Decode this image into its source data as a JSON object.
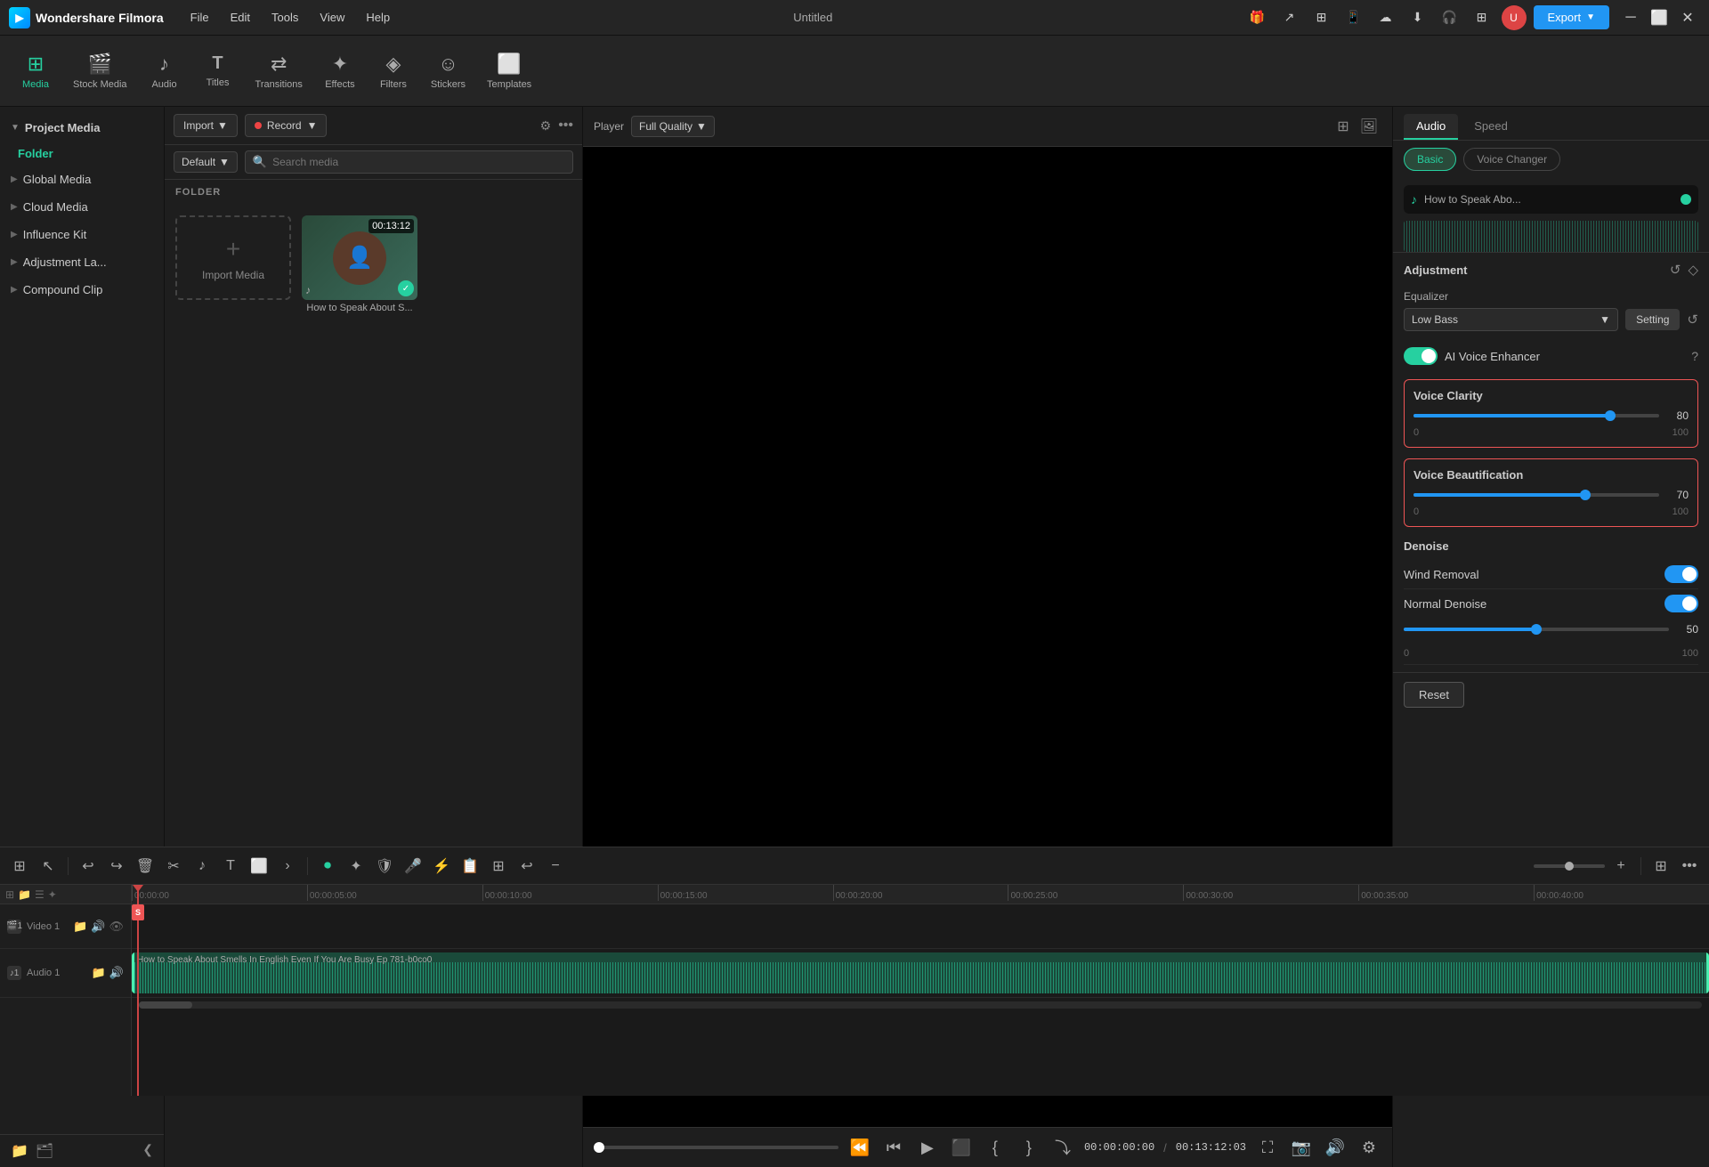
{
  "app": {
    "name": "Wondershare Filmora",
    "title": "Untitled"
  },
  "menu": {
    "items": [
      "File",
      "Edit",
      "Tools",
      "View",
      "Help"
    ]
  },
  "toolbar": {
    "items": [
      {
        "id": "media",
        "label": "Media",
        "icon": "⊞",
        "active": true
      },
      {
        "id": "stock",
        "label": "Stock Media",
        "icon": "🎬"
      },
      {
        "id": "audio",
        "label": "Audio",
        "icon": "♪"
      },
      {
        "id": "titles",
        "label": "Titles",
        "icon": "T"
      },
      {
        "id": "transitions",
        "label": "Transitions",
        "icon": "⇄"
      },
      {
        "id": "effects",
        "label": "Effects",
        "icon": "✦"
      },
      {
        "id": "filters",
        "label": "Filters",
        "icon": "◈"
      },
      {
        "id": "stickers",
        "label": "Stickers",
        "icon": "☺"
      },
      {
        "id": "templates",
        "label": "Templates",
        "icon": "⬜"
      }
    ]
  },
  "sidebar": {
    "items": [
      {
        "label": "Project Media",
        "expanded": true
      },
      {
        "label": "Folder",
        "sub": true
      },
      {
        "label": "Global Media"
      },
      {
        "label": "Cloud Media"
      },
      {
        "label": "Influence Kit"
      },
      {
        "label": "Adjustment La..."
      },
      {
        "label": "Compound Clip"
      }
    ]
  },
  "media_panel": {
    "import_label": "Import",
    "record_label": "Record",
    "sort_label": "Default",
    "search_placeholder": "Search media",
    "folder_label": "FOLDER",
    "import_card_label": "Import Media",
    "media_items": [
      {
        "name": "How to Speak About S...",
        "duration": "00:13:12",
        "has_check": true
      }
    ]
  },
  "preview": {
    "player_label": "Player",
    "quality": "Full Quality",
    "time_current": "00:00:00:00",
    "time_total": "00:13:12:03",
    "time_separator": "/"
  },
  "right_panel": {
    "tabs": [
      "Audio",
      "Speed"
    ],
    "active_tab": "Audio",
    "subtabs": [
      "Basic",
      "Voice Changer"
    ],
    "active_subtab": "Basic",
    "track_name": "How to Speak Abo...",
    "adjustment_label": "Adjustment",
    "equalizer_label": "Equalizer",
    "eq_preset": "Low Bass",
    "eq_setting_btn": "Setting",
    "ai_enhancer_label": "AI Voice Enhancer",
    "voice_clarity": {
      "title": "Voice Clarity",
      "value": 80,
      "min": 0,
      "max": 100,
      "percent": 80
    },
    "voice_beautification": {
      "title": "Voice Beautification",
      "value": 70,
      "min": 0,
      "max": 100,
      "percent": 70
    },
    "denoise_title": "Denoise",
    "wind_removal_label": "Wind Removal",
    "normal_denoise_label": "Normal Denoise",
    "normal_denoise_value": 50,
    "normal_denoise_min": 0,
    "normal_denoise_max": 100,
    "reset_btn": "Reset"
  },
  "timeline": {
    "tracks": [
      {
        "type": "video",
        "num": 1,
        "name": "Video 1"
      },
      {
        "type": "audio",
        "num": 1,
        "name": "Audio 1",
        "clip": "How to Speak About Smells In English Even If You Are Busy Ep 781-b0co0"
      }
    ],
    "time_markers": [
      "00:00:00",
      "00:00:05:00",
      "00:00:10:00",
      "00:00:15:00",
      "00:00:20:00",
      "00:00:25:00",
      "00:00:30:00",
      "00:00:35:00",
      "00:00:40:00"
    ]
  },
  "colors": {
    "accent": "#26d0a0",
    "blue": "#2196f3",
    "red": "#e55555",
    "bg_dark": "#1a1a1a",
    "bg_medium": "#1e1e1e",
    "border": "#333333"
  }
}
